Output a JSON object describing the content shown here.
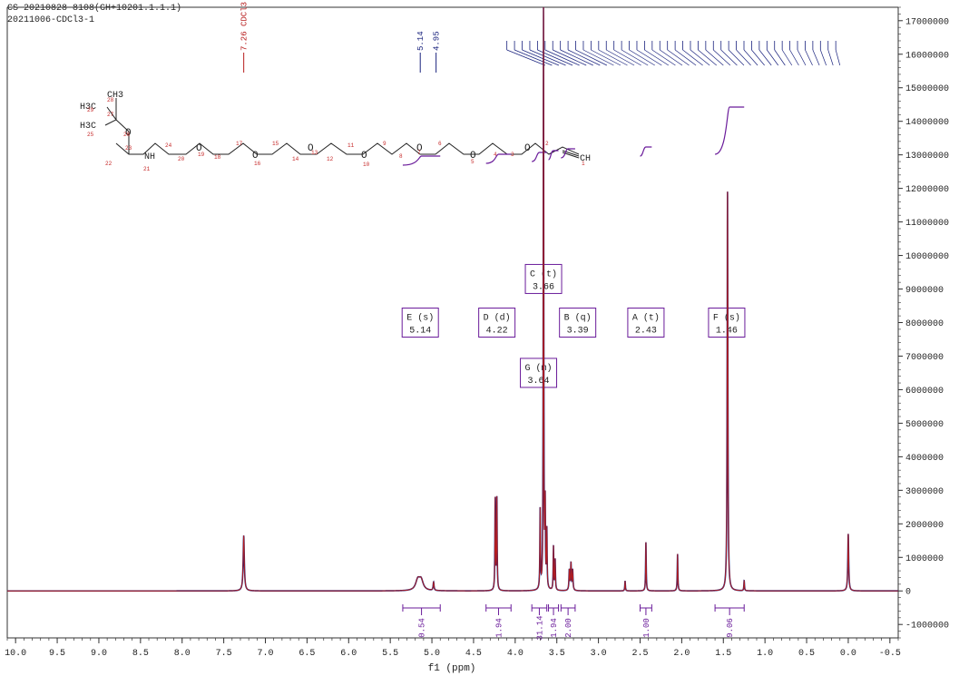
{
  "header": {
    "line1": "CS-20210828-8108(GH+10201.1.1.1)",
    "line2": "20211006-CDCl3-1"
  },
  "chart_data": {
    "type": "line",
    "xlabel": "f1 (ppm)",
    "xlim": [
      10.1,
      -0.6
    ],
    "x_ticks": [
      "10.0",
      "9.5",
      "9.0",
      "8.5",
      "8.0",
      "7.5",
      "7.0",
      "6.5",
      "6.0",
      "5.5",
      "5.0",
      "4.5",
      "4.0",
      "3.5",
      "3.0",
      "2.5",
      "2.0",
      "1.5",
      "1.0",
      "0.5",
      "0.0",
      "-0.5"
    ],
    "ylim": [
      -1400000,
      17400000
    ],
    "y_ticks": [
      "-1000000",
      "0",
      "1000000",
      "2000000",
      "3000000",
      "4000000",
      "5000000",
      "6000000",
      "7000000",
      "8000000",
      "9000000",
      "10000000",
      "11000000",
      "12000000",
      "13000000",
      "14000000",
      "15000000",
      "16000000",
      "17000000"
    ],
    "peaks": [
      {
        "ppm": 7.26,
        "h": 1650000,
        "w": 0.008
      },
      {
        "ppm": 5.17,
        "h": 300000,
        "w": 0.03
      },
      {
        "ppm": 5.13,
        "h": 300000,
        "w": 0.03
      },
      {
        "ppm": 4.98,
        "h": 250000,
        "w": 0.006
      },
      {
        "ppm": 4.24,
        "h": 2700000,
        "w": 0.004
      },
      {
        "ppm": 4.22,
        "h": 2720000,
        "w": 0.004
      },
      {
        "ppm": 3.7,
        "h": 2350000,
        "w": 0.004
      },
      {
        "ppm": 3.66,
        "h": 17400000,
        "w": 0.0035
      },
      {
        "ppm": 3.64,
        "h": 2400000,
        "w": 0.004
      },
      {
        "ppm": 3.62,
        "h": 1700000,
        "w": 0.004
      },
      {
        "ppm": 3.54,
        "h": 1300000,
        "w": 0.004
      },
      {
        "ppm": 3.52,
        "h": 900000,
        "w": 0.004
      },
      {
        "ppm": 3.35,
        "h": 600000,
        "w": 0.005
      },
      {
        "ppm": 3.33,
        "h": 800000,
        "w": 0.005
      },
      {
        "ppm": 3.31,
        "h": 600000,
        "w": 0.005
      },
      {
        "ppm": 2.68,
        "h": 300000,
        "w": 0.004
      },
      {
        "ppm": 2.43,
        "h": 1450000,
        "w": 0.004
      },
      {
        "ppm": 2.05,
        "h": 1100000,
        "w": 0.004
      },
      {
        "ppm": 1.45,
        "h": 11900000,
        "w": 0.005
      },
      {
        "ppm": 1.25,
        "h": 300000,
        "w": 0.004
      },
      {
        "ppm": 0.0,
        "h": 1700000,
        "w": 0.006
      }
    ],
    "top_labels": [
      {
        "ppm": 7.26,
        "text": "7.26 CDCl3"
      },
      {
        "ppm": 5.14,
        "text": "5.14"
      },
      {
        "ppm": 4.95,
        "text": "4.95"
      }
    ],
    "multiplets": [
      {
        "ppm": 5.14,
        "name": "E (s)",
        "value": "5.14",
        "level": 8000000
      },
      {
        "ppm": 4.22,
        "name": "D (d)",
        "value": "4.22",
        "level": 8000000
      },
      {
        "ppm": 3.66,
        "name": "C (t)",
        "value": "3.66",
        "level": 9300000
      },
      {
        "ppm": 3.39,
        "name": "B (q)",
        "value": "3.39",
        "level": 8000000
      },
      {
        "ppm": 3.64,
        "name": "G (m)",
        "value": "3.64",
        "level": 6500000
      },
      {
        "ppm": 2.43,
        "name": "A (t)",
        "value": "2.43",
        "level": 8000000
      },
      {
        "ppm": 1.46,
        "name": "F (s)",
        "value": "1.46",
        "level": 8000000
      }
    ],
    "integrals": [
      {
        "from": 5.35,
        "to": 4.9,
        "value": "0.54"
      },
      {
        "from": 4.35,
        "to": 4.05,
        "value": "1.94"
      },
      {
        "from": 3.8,
        "to": 3.62,
        "value": "31.14"
      },
      {
        "from": 3.6,
        "to": 3.48,
        "value": "1.94"
      },
      {
        "from": 3.45,
        "to": 3.28,
        "value": "2.00"
      },
      {
        "from": 2.5,
        "to": 2.36,
        "value": "1.00"
      },
      {
        "from": 1.6,
        "to": 1.25,
        "value": "9.06"
      }
    ],
    "structure": {
      "oxygens": [
        "O",
        "O",
        "O",
        "O",
        "O",
        "O",
        "O",
        "O"
      ],
      "methyl_a": "H3C",
      "methyl_b": "CH3",
      "methyl_c": "H3C",
      "amine": "NH",
      "terminal": "CH",
      "numbers": [
        "28",
        "29",
        "27",
        "26",
        "25",
        "23",
        "24",
        "22",
        "21",
        "20",
        "19",
        "18",
        "17",
        "16",
        "15",
        "14",
        "13",
        "12",
        "11",
        "10",
        "9",
        "8",
        "7",
        "6",
        "5",
        "4",
        "3",
        "2",
        "1"
      ]
    }
  }
}
